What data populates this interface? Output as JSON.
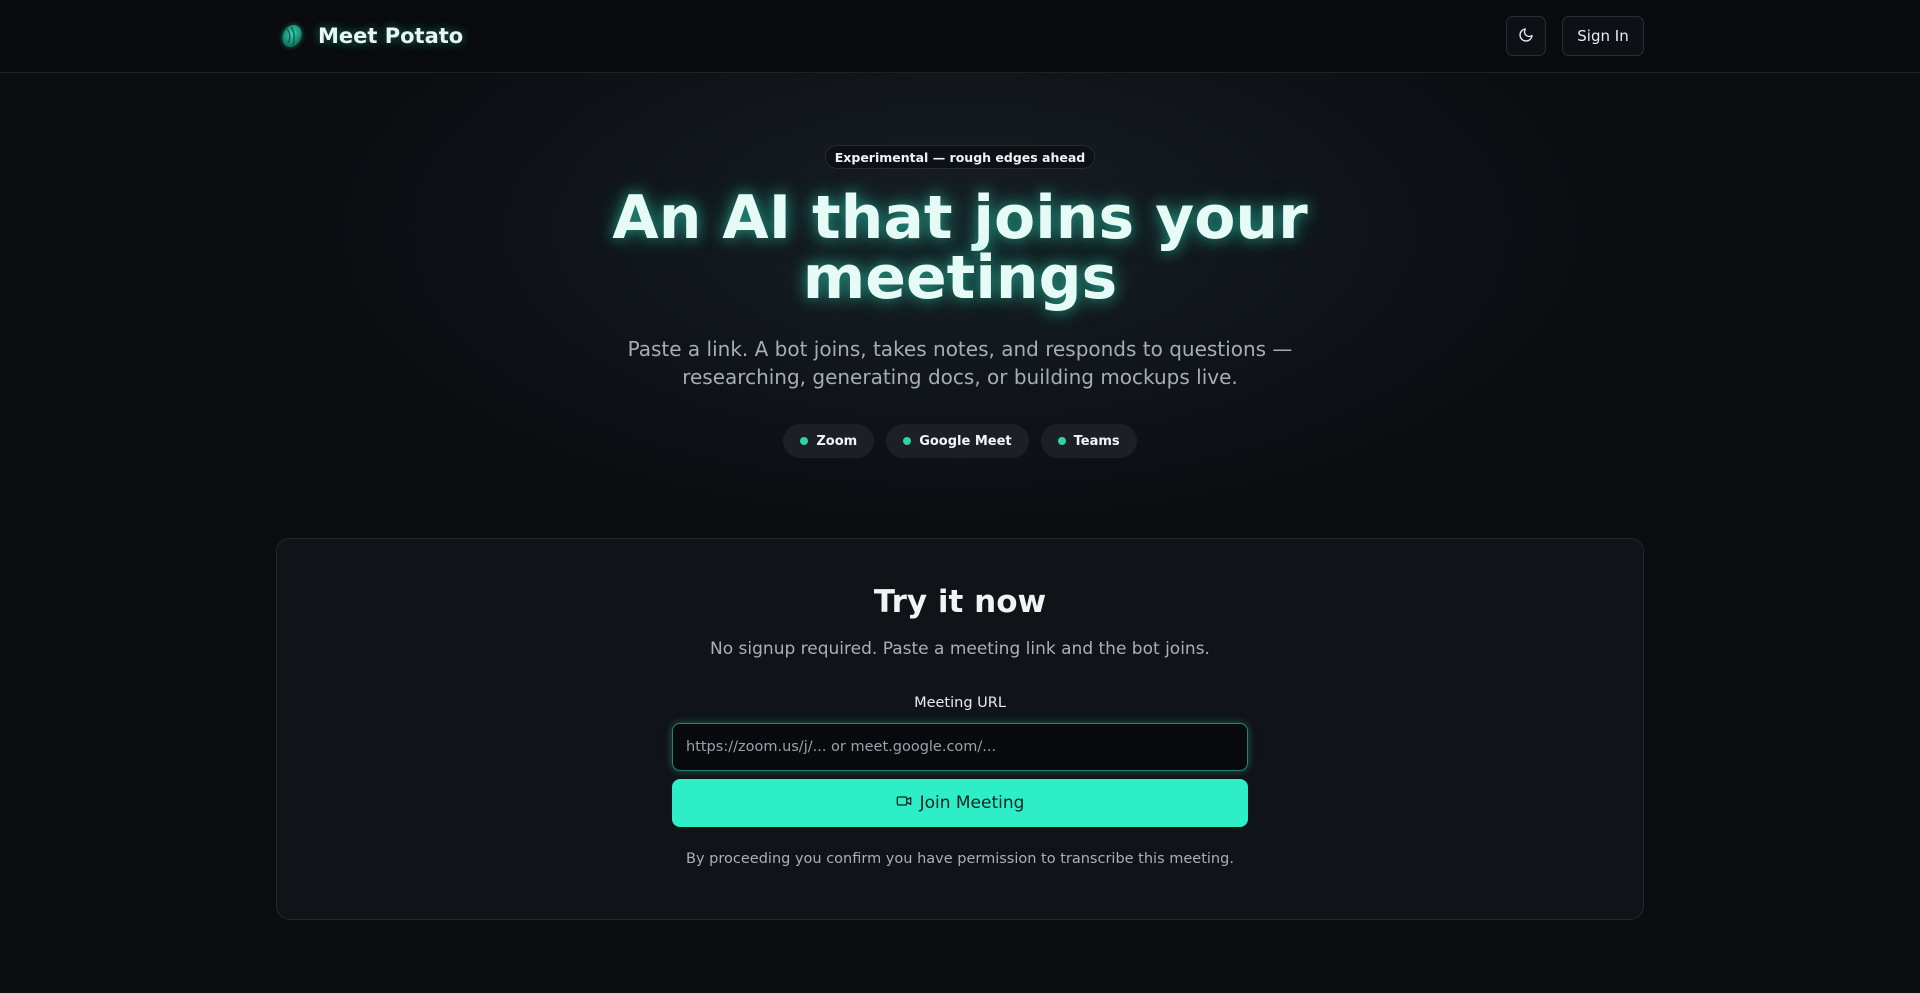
{
  "header": {
    "brand_name": "Meet Potato",
    "signin_label": "Sign In",
    "theme_icon": "moon-icon",
    "logo_icon": "potato-logo-icon"
  },
  "hero": {
    "badge": "Experimental — rough edges ahead",
    "title_line1": "An AI that joins your",
    "title_line2": "meetings",
    "subtitle_line1": "Paste a link. A bot joins, takes notes, and responds to questions —",
    "subtitle_line2": "researching, generating docs, or building mockups live.",
    "platforms": [
      "Zoom",
      "Google Meet",
      "Teams"
    ]
  },
  "try_card": {
    "title": "Try it now",
    "subtitle": "No signup required. Paste a meeting link and the bot joins.",
    "field_label": "Meeting URL",
    "url_value": "",
    "url_placeholder": "https://zoom.us/j/... or meet.google.com/...",
    "join_label": "Join Meeting",
    "join_icon": "video-camera-icon",
    "consent": "By proceeding you confirm you have permission to transcribe this meeting."
  },
  "colors": {
    "accent": "#2eeec8",
    "background": "#0b0d11",
    "card": "#101317",
    "status_dot": "#2bd4a9"
  }
}
